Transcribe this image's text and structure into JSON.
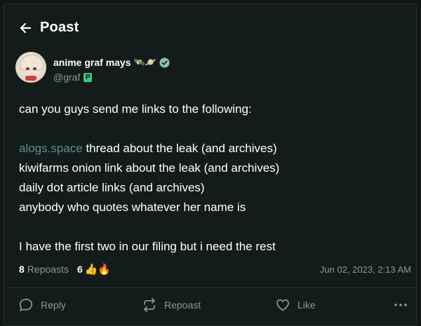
{
  "header": {
    "title": "Poast"
  },
  "author": {
    "display_name": "anime graf mays",
    "name_emoji": "🛰️🪐",
    "handle": "@graf",
    "handle_badge": "P"
  },
  "post": {
    "lines": [
      {
        "link": "",
        "text": "can you guys send me links to the following:"
      },
      {
        "link": "",
        "text": ""
      },
      {
        "link": "alogs.space",
        "text": " thread about the leak (and archives)"
      },
      {
        "link": "",
        "text": "kiwifarms onion link about the leak (and archives)"
      },
      {
        "link": "",
        "text": "daily dot article links (and archives)"
      },
      {
        "link": "",
        "text": "anybody who quotes whatever her name is"
      },
      {
        "link": "",
        "text": ""
      },
      {
        "link": "",
        "text": "I have the first two in our filing but i need the rest"
      }
    ]
  },
  "stats": {
    "repost_count": "8",
    "repost_label": "Repoasts",
    "reaction_count": "6",
    "reaction_emoji": "👍🔥",
    "timestamp": "Jun 02, 2023, 2:13 AM"
  },
  "actions": {
    "reply_label": "Reply",
    "repost_label": "Repoast",
    "like_label": "Like"
  },
  "colors": {
    "link": "#5d8f86",
    "verified": "#8fc0a9",
    "badge": "#2fd07c"
  }
}
